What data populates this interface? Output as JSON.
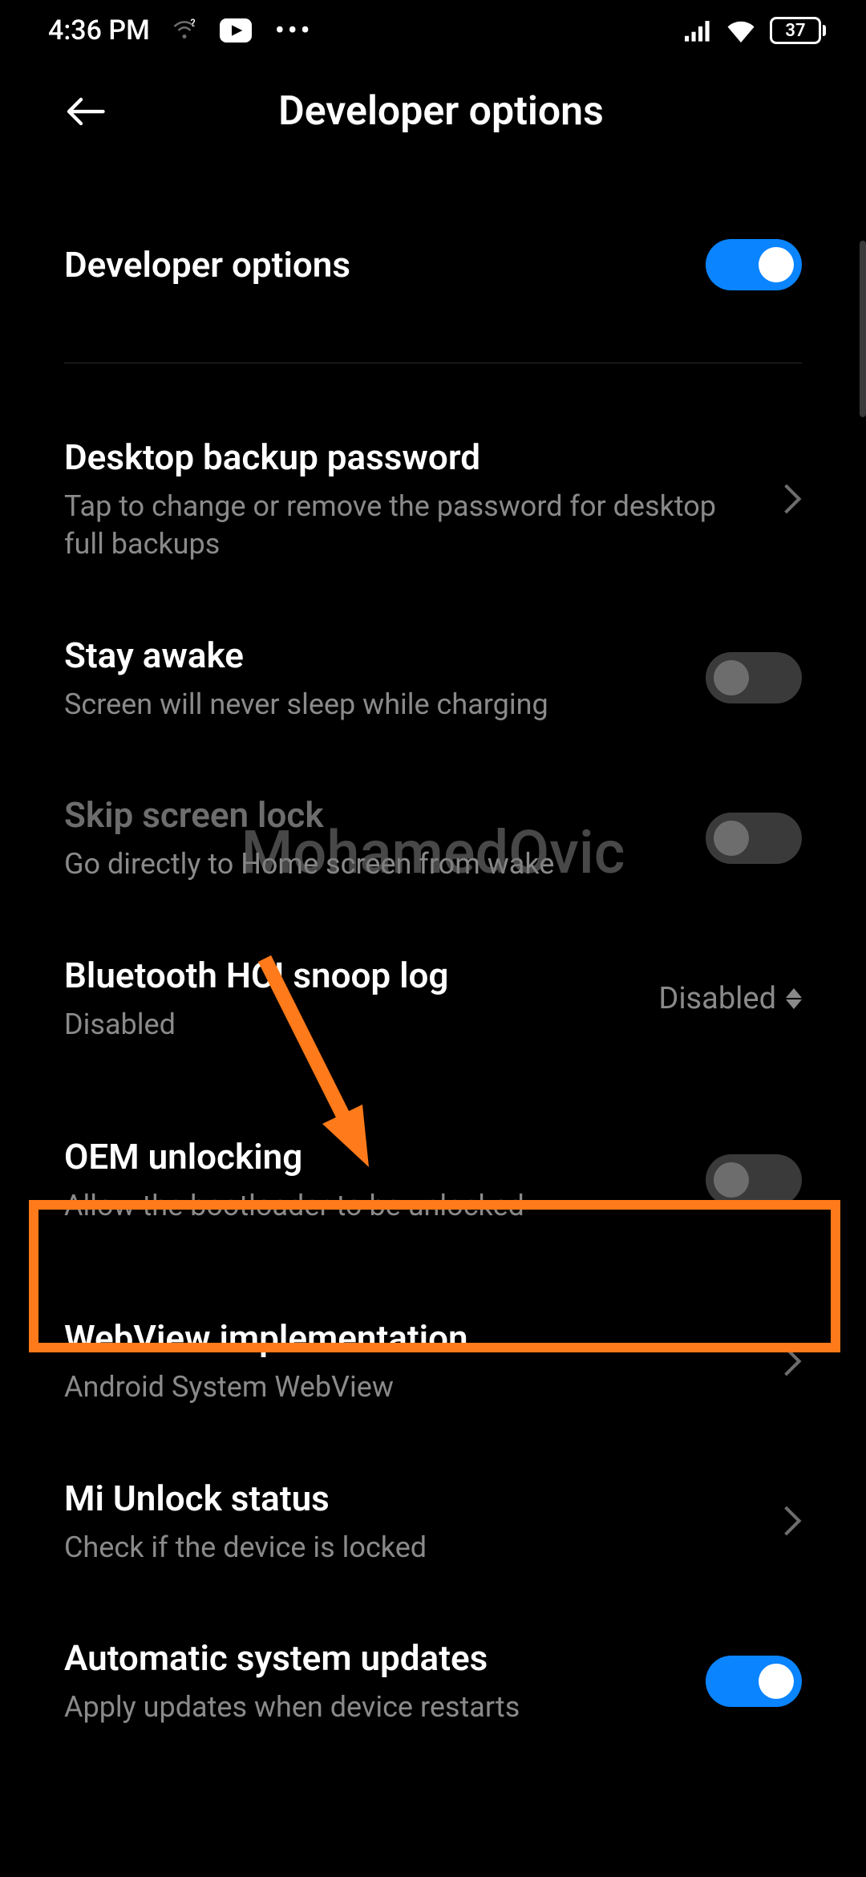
{
  "status": {
    "time": "4:36 PM",
    "battery_percent": "37"
  },
  "header": {
    "title": "Developer options"
  },
  "items": {
    "developer_options": {
      "title": "Developer options"
    },
    "desktop_backup": {
      "title": "Desktop backup password",
      "subtitle": "Tap to change or remove the password for desktop full backups"
    },
    "stay_awake": {
      "title": "Stay awake",
      "subtitle": "Screen will never sleep while charging"
    },
    "skip_screen_lock": {
      "title": "Skip screen lock",
      "subtitle": "Go directly to Home screen from wake"
    },
    "bt_hci": {
      "title": "Bluetooth HCI snoop log",
      "subtitle": "Disabled",
      "value": "Disabled"
    },
    "oem_unlock": {
      "title": "OEM unlocking",
      "subtitle": "Allow the bootloader to be unlocked"
    },
    "webview": {
      "title": "WebView implementation",
      "subtitle": "Android System WebView"
    },
    "mi_unlock": {
      "title": "Mi Unlock status",
      "subtitle": "Check if the device is locked"
    },
    "auto_update": {
      "title": "Automatic system updates",
      "subtitle": "Apply updates when device restarts"
    }
  },
  "watermark": "MohamedOvic"
}
